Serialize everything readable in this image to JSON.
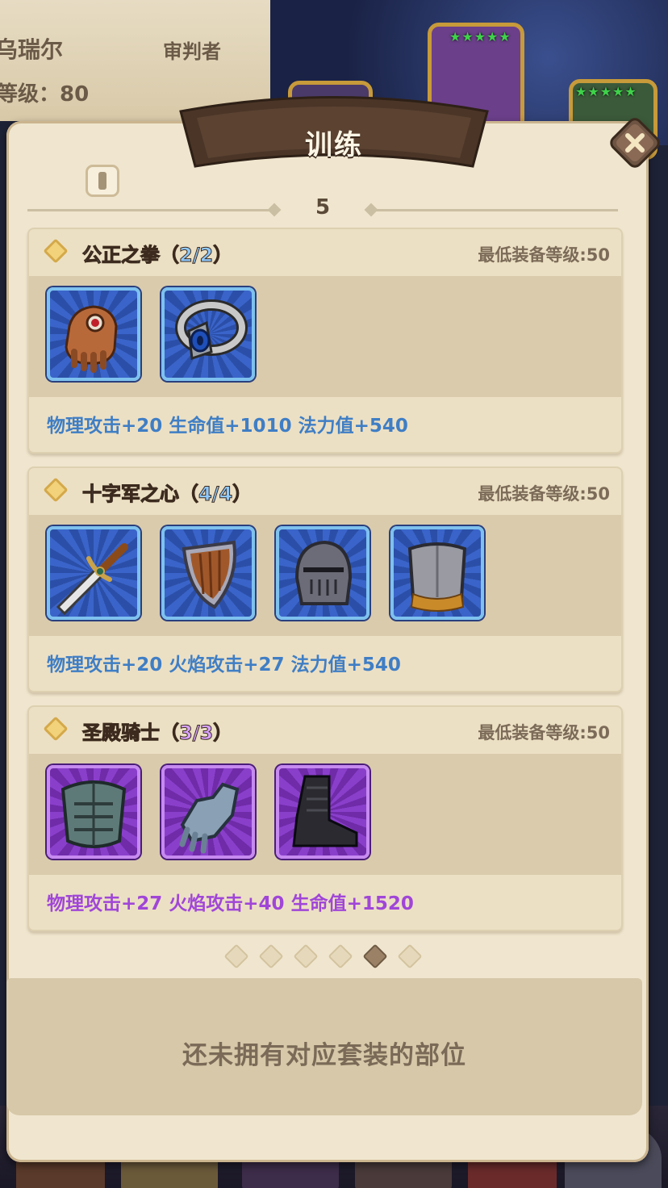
{
  "background": {
    "hero_name": "乌瑞尔",
    "hero_role": "审判者",
    "hero_level": "等级：80",
    "stars": "★★★★★"
  },
  "dialog": {
    "title": "训练",
    "level": "5"
  },
  "sets": [
    {
      "name": "公正之拳（2/2）",
      "requirement": "最低装备等级:50",
      "quality": "blue",
      "items": [
        "gauntlet-icon",
        "ring-icon"
      ],
      "bonus": "物理攻击+20  生命值+1010  法力值+540"
    },
    {
      "name": "十字军之心（4/4）",
      "requirement": "最低装备等级:50",
      "quality": "blue",
      "items": [
        "sword-icon",
        "shield-icon",
        "helmet-icon",
        "chest-armor-icon"
      ],
      "bonus": "物理攻击+20  火焰攻击+27  法力值+540"
    },
    {
      "name": "圣殿骑士（3/3）",
      "requirement": "最低装备等级:50",
      "quality": "purple",
      "items": [
        "plate-armor-icon",
        "gloves-icon",
        "boots-icon"
      ],
      "bonus": "物理攻击+27  火焰攻击+40  生命值+1520"
    }
  ],
  "pager": {
    "total": 6,
    "active_index": 4
  },
  "footer": {
    "message": "还未拥有对应套装的部位"
  },
  "colors": {
    "panel": "#f0e6cf",
    "blue_quality": "#3f7ec5",
    "purple_quality": "#a046d8",
    "banner": "#4b3527"
  }
}
